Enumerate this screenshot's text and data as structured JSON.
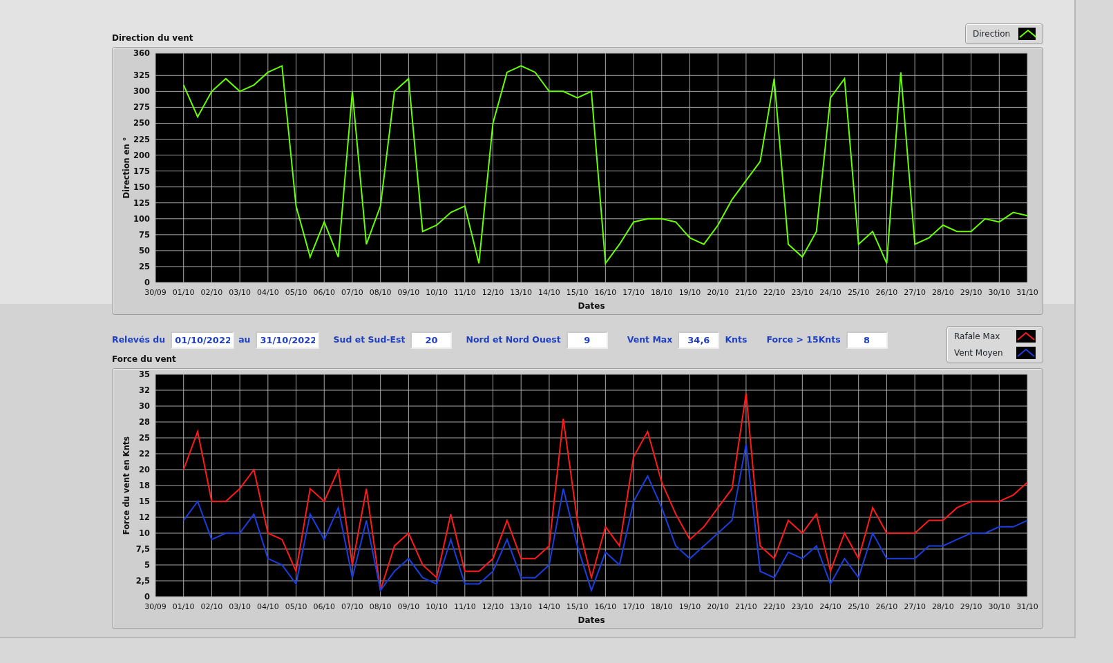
{
  "direction_panel": {
    "title": "Direction du vent",
    "chart_data": {
      "type": "line",
      "grid": true,
      "xlabel": "Dates",
      "ylabel": "Direction en °",
      "ylim": [
        0,
        360
      ],
      "categories": [
        "30/09",
        null,
        "01/10",
        null,
        "02/10",
        null,
        "03/10",
        null,
        "04/10",
        null,
        "05/10",
        null,
        "06/10",
        null,
        "07/10",
        null,
        "08/10",
        null,
        "09/10",
        null,
        "10/10",
        null,
        "11/10",
        null,
        "12/10",
        null,
        "13/10",
        null,
        "14/10",
        null,
        "15/10",
        null,
        "16/10",
        null,
        "17/10",
        null,
        "18/10",
        null,
        "19/10",
        null,
        "20/10",
        null,
        "21/10",
        null,
        "22/10",
        null,
        "23/10",
        null,
        "24/10",
        null,
        "25/10",
        null,
        "26/10",
        null,
        "27/10",
        null,
        "28/10",
        null,
        "29/10",
        null,
        "30/10",
        null,
        "31/10"
      ],
      "series": [
        {
          "name": "Direction",
          "color": "#66ff00",
          "values": [
            null,
            null,
            310,
            260,
            300,
            320,
            300,
            310,
            330,
            340,
            120,
            40,
            95,
            40,
            300,
            60,
            120,
            300,
            320,
            80,
            90,
            110,
            120,
            30,
            250,
            330,
            340,
            330,
            300,
            300,
            290,
            300,
            30,
            60,
            95,
            100,
            100,
            95,
            70,
            60,
            90,
            130,
            160,
            190,
            320,
            60,
            40,
            80,
            290,
            320,
            60,
            80,
            30,
            330,
            60,
            70,
            90,
            80,
            80,
            100,
            95,
            110,
            105
          ]
        }
      ],
      "yticks": [
        0,
        25,
        50,
        75,
        100,
        125,
        150,
        175,
        200,
        225,
        250,
        275,
        300,
        325,
        360
      ]
    }
  },
  "filters": [
    {
      "label": "Relevés du",
      "value": "01/10/2022"
    },
    {
      "label": "au",
      "value": "31/10/2022"
    },
    {
      "label": "Sud et Sud-Est",
      "value": "20"
    },
    {
      "label": "Nord et Nord Ouest",
      "value": "9"
    },
    {
      "label": "Vent Max",
      "value": "34,6",
      "unit": "Knts"
    },
    {
      "label": "Force > 15Knts",
      "value": "8"
    }
  ],
  "force_panel": {
    "title": "Force du vent",
    "chart_data": {
      "type": "line",
      "grid": true,
      "xlabel": "Dates",
      "ylabel": "Force du vent en Knts",
      "ylim": [
        0,
        35
      ],
      "categories": [
        "30/09",
        null,
        "01/10",
        null,
        "02/10",
        null,
        "03/10",
        null,
        "04/10",
        null,
        "05/10",
        null,
        "06/10",
        null,
        "07/10",
        null,
        "08/10",
        null,
        "09/10",
        null,
        "10/10",
        null,
        "11/10",
        null,
        "12/10",
        null,
        "13/10",
        null,
        "14/10",
        null,
        "15/10",
        null,
        "16/10",
        null,
        "17/10",
        null,
        "18/10",
        null,
        "19/10",
        null,
        "20/10",
        null,
        "21/10",
        null,
        "22/10",
        null,
        "23/10",
        null,
        "24/10",
        null,
        "25/10",
        null,
        "26/10",
        null,
        "27/10",
        null,
        "28/10",
        null,
        "29/10",
        null,
        "30/10",
        null,
        "31/10"
      ],
      "series": [
        {
          "name": "Rafale Max",
          "color": "#ff1a1a",
          "values": [
            null,
            null,
            20,
            26,
            15,
            15,
            17,
            20,
            10,
            9,
            4,
            17,
            15,
            20,
            5,
            17,
            1,
            8,
            10,
            5,
            3,
            13,
            4,
            4,
            6,
            12,
            6,
            6,
            8,
            28,
            12,
            3,
            11,
            8,
            22,
            26,
            18,
            13,
            9,
            11,
            14,
            17,
            32,
            8,
            6,
            12,
            10,
            13,
            4,
            10,
            6,
            14,
            10,
            10,
            10,
            12,
            12,
            14,
            15,
            15,
            15,
            16,
            18
          ]
        },
        {
          "name": "Vent Moyen",
          "color": "#1a3fe0",
          "values": [
            null,
            null,
            12,
            15,
            9,
            10,
            10,
            13,
            6,
            5,
            2,
            13,
            9,
            14,
            3,
            12,
            1,
            4,
            6,
            3,
            2,
            9,
            2,
            2,
            4,
            9,
            3,
            3,
            5,
            17,
            8,
            1,
            7,
            5,
            15,
            19,
            14,
            8,
            6,
            8,
            10,
            12,
            24,
            4,
            3,
            7,
            6,
            8,
            2,
            6,
            3,
            10,
            6,
            6,
            6,
            8,
            8,
            9,
            10,
            10,
            11,
            11,
            12
          ]
        }
      ],
      "yticks": [
        0,
        {
          "value": 2.5,
          "label": "2,5"
        },
        5,
        {
          "value": 7.5,
          "label": "7,5"
        },
        10,
        {
          "value": 12.5,
          "label": "12"
        },
        15,
        {
          "value": 17.5,
          "label": "18"
        },
        20,
        {
          "value": 22.5,
          "label": "22"
        },
        25,
        {
          "value": 27.5,
          "label": "28"
        },
        30,
        {
          "value": 32.5,
          "label": "32"
        },
        35
      ]
    }
  }
}
